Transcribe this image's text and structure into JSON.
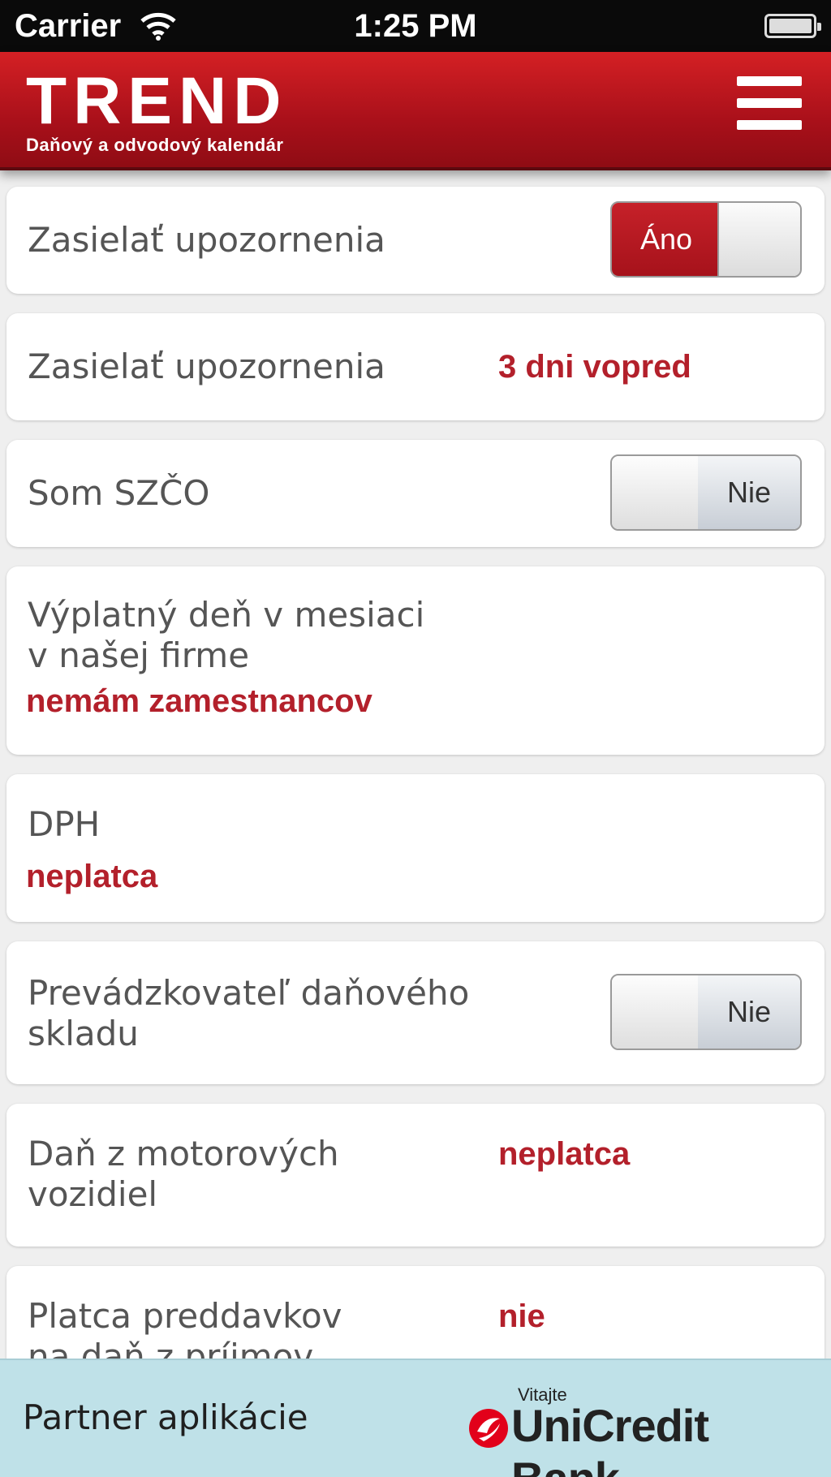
{
  "status_bar": {
    "carrier": "Carrier",
    "time": "1:25 PM",
    "wifi_icon": "wifi-icon",
    "battery_icon": "battery-icon"
  },
  "header": {
    "title": "TREND",
    "subtitle": "Daňový a odvodový kalendár",
    "menu_icon": "hamburger-menu-icon"
  },
  "settings": {
    "notifications": {
      "label": "Zasielať upozornenia",
      "toggle_label": "Áno",
      "state": "on"
    },
    "notify_advance": {
      "label": "Zasielať upozornenia",
      "value": "3 dni vopred"
    },
    "szco": {
      "label": "Som SZČO",
      "toggle_label": "Nie",
      "state": "off"
    },
    "payday": {
      "label_line1": "Výplatný deň v mesiaci",
      "label_line2": "v našej firme",
      "value": "nemám zamestnancov"
    },
    "dph": {
      "label": "DPH",
      "value": "neplatca"
    },
    "tax_warehouse": {
      "label_line1": "Prevádzkovateľ daňového",
      "label_line2": "skladu",
      "toggle_label": "Nie",
      "state": "off"
    },
    "motor_vehicle_tax": {
      "label_line1": "Daň z motorových",
      "label_line2": "vozidiel",
      "value": "neplatca"
    },
    "income_tax_advances": {
      "label_line1": "Platca preddavkov",
      "label_line2": "na daň z príjmov",
      "value": "nie"
    }
  },
  "footer": {
    "label": "Partner aplikácie",
    "partner_greeting": "Vitajte",
    "partner_name": "UniCredit Bank",
    "partner_logo_icon": "unicredit-logo-icon"
  },
  "colors": {
    "brand_red": "#b3202b",
    "header_red": "#c41a20",
    "footer_bg": "#bfe1e8"
  }
}
